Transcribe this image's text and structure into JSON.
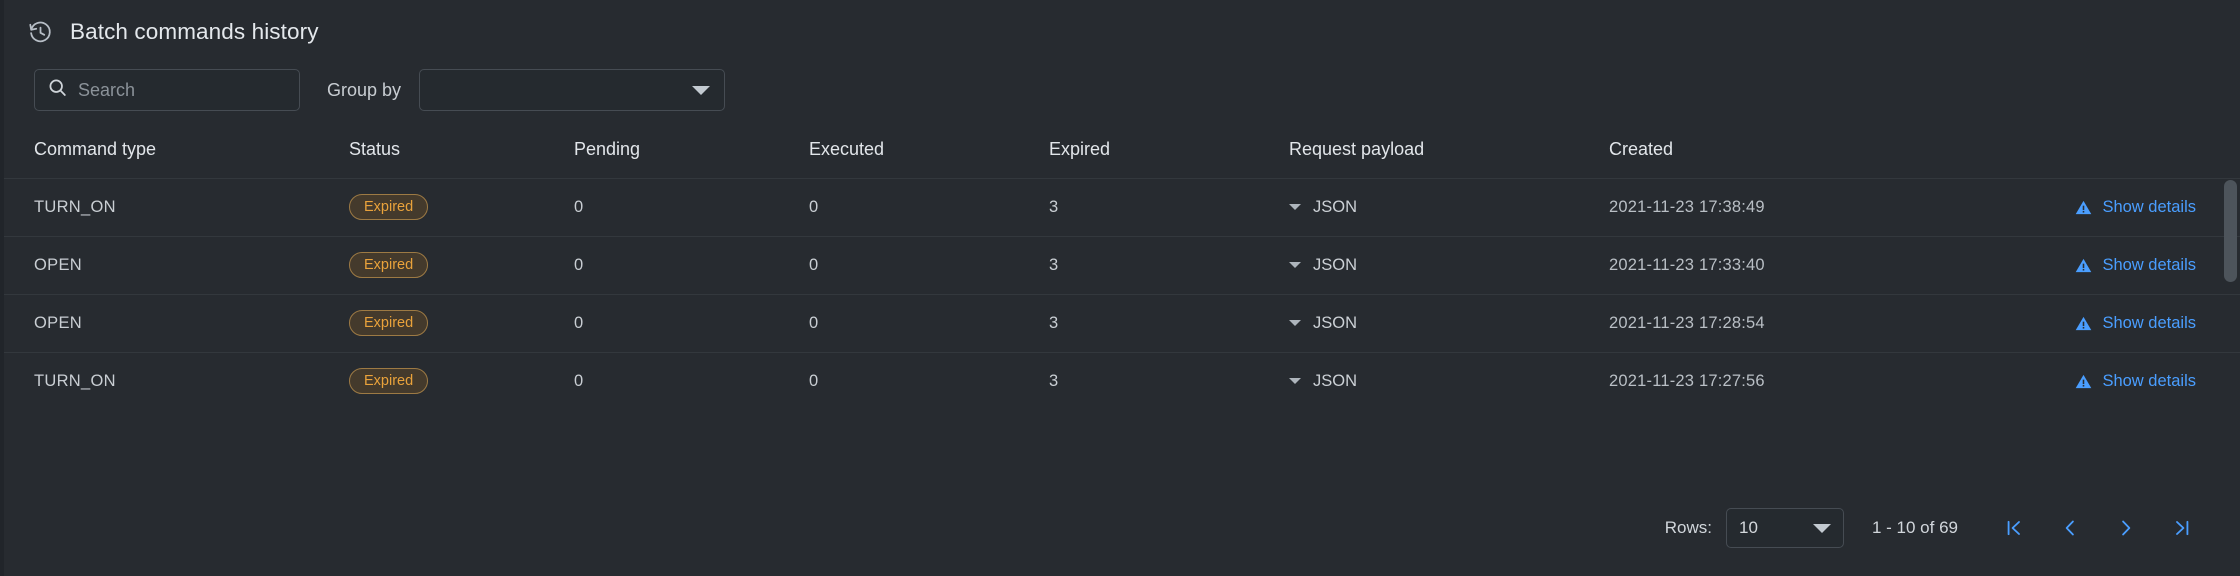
{
  "header": {
    "icon": "history-clock-icon",
    "title": "Batch commands history"
  },
  "filters": {
    "search": {
      "icon": "search-icon",
      "value": "",
      "placeholder": "Search"
    },
    "group_by": {
      "label": "Group by",
      "value": "",
      "placeholder": "",
      "icon": "chevron-down-icon"
    }
  },
  "table": {
    "columns": [
      "Command type",
      "Status",
      "Pending",
      "Executed",
      "Expired",
      "Request payload",
      "Created",
      ""
    ],
    "rows": [
      {
        "command_type": "TURN_ON",
        "status": "Expired",
        "pending": "0",
        "executed": "0",
        "expired": "3",
        "payload": "JSON",
        "created": "2021-11-23 17:38:49",
        "action": "Show details"
      },
      {
        "command_type": "OPEN",
        "status": "Expired",
        "pending": "0",
        "executed": "0",
        "expired": "3",
        "payload": "JSON",
        "created": "2021-11-23 17:33:40",
        "action": "Show details"
      },
      {
        "command_type": "OPEN",
        "status": "Expired",
        "pending": "0",
        "executed": "0",
        "expired": "3",
        "payload": "JSON",
        "created": "2021-11-23 17:28:54",
        "action": "Show details"
      },
      {
        "command_type": "TURN_ON",
        "status": "Expired",
        "pending": "0",
        "executed": "0",
        "expired": "3",
        "payload": "JSON",
        "created": "2021-11-23 17:27:56",
        "action": "Show details"
      }
    ]
  },
  "pagination": {
    "rows_label": "Rows:",
    "rows_per_page": "10",
    "range": "1 - 10 of 69",
    "first_icon": "first-page-icon",
    "prev_icon": "previous-page-icon",
    "next_icon": "next-page-icon",
    "last_icon": "last-page-icon"
  },
  "colors": {
    "background": "#272b30",
    "accent_link": "#4a9eff",
    "status_text": "#e9a23b",
    "status_bg": "#443a2c",
    "status_border": "#9d7a44",
    "divider": "#33383d"
  }
}
